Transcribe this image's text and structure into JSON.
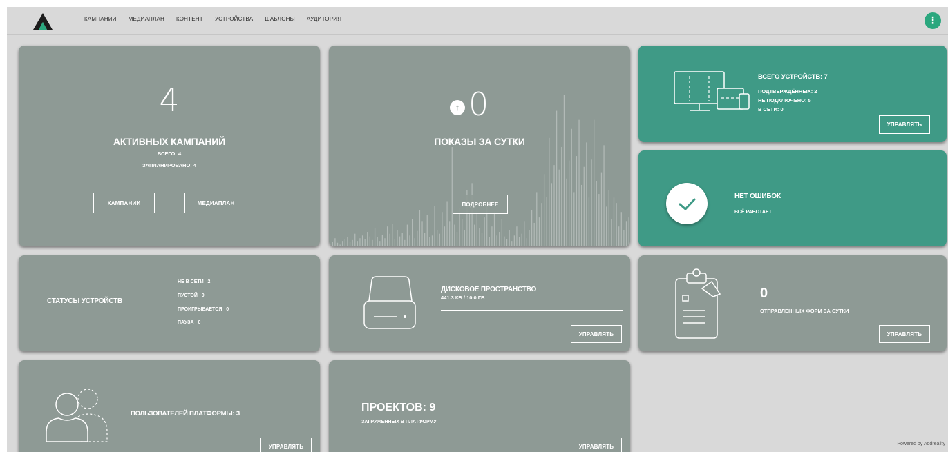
{
  "nav": {
    "items": [
      "КАМПАНИИ",
      "МЕДИАПЛАН",
      "КОНТЕНТ",
      "УСТРОЙСТВА",
      "ШАБЛОНЫ",
      "АУДИТОРИЯ"
    ],
    "menu_icon": "⋮"
  },
  "colors": {
    "card_gray": "#8e9a95",
    "card_teal": "#3f9a86",
    "accent": "#2aa77e"
  },
  "campaigns": {
    "count": "4",
    "title": "АКТИВНЫХ КАМПАНИЙ",
    "total": "ВСЕГО: 4",
    "scheduled": "ЗАПЛАНИРОВАНО: 4",
    "btn_campaigns": "КАМПАНИИ",
    "btn_mediaplan": "МЕДИАПЛАН"
  },
  "impressions": {
    "count": "0",
    "title": "ПОКАЗЫ ЗА СУТКИ",
    "btn_details": "ПОДРОБНЕЕ",
    "bars": [
      3,
      5,
      9,
      4,
      2,
      6,
      8,
      10,
      5,
      7,
      14,
      6,
      9,
      12,
      8,
      16,
      11,
      7,
      20,
      10,
      6,
      13,
      9,
      22,
      14,
      25,
      8,
      18,
      11,
      15,
      7,
      24,
      12,
      30,
      9,
      17,
      40,
      28,
      15,
      35,
      10,
      12,
      45,
      18,
      14,
      38,
      22,
      50,
      28,
      110,
      24,
      16,
      42,
      30,
      18,
      62,
      36,
      70,
      24,
      40,
      20,
      15,
      32,
      48,
      10,
      22,
      38,
      12,
      16,
      30,
      11,
      8,
      18,
      6,
      12,
      22,
      10,
      14,
      28,
      9,
      18,
      40,
      26,
      60,
      32,
      48,
      80,
      55,
      120,
      70,
      90,
      150,
      85,
      110,
      168,
      75,
      95,
      130,
      60,
      100,
      140,
      68,
      88,
      115,
      54,
      96,
      140,
      72,
      58,
      82,
      112,
      44,
      62,
      30,
      54,
      48,
      22,
      38,
      18,
      28,
      32
    ]
  },
  "devices": {
    "total": "ВСЕГО УСТРОЙСТВ: 7",
    "confirmed": "ПОДТВЕРЖДЁННЫХ: 2",
    "not_connected": "НЕ ПОДКЛЮЧЕНО: 5",
    "online": "В СЕТИ: 0",
    "btn_manage": "УПРАВЛЯТЬ"
  },
  "errors": {
    "title": "НЕТ ОШИБОК",
    "subtitle": "ВСЁ РАБОТАЕТ"
  },
  "device_status": {
    "title": "СТАТУСЫ УСТРОЙСТВ",
    "rows": [
      {
        "label": "НЕ В СЕТИ",
        "value": "2"
      },
      {
        "label": "ПУСТОЙ",
        "value": "0"
      },
      {
        "label": "ПРОИГРЫВАЕТСЯ",
        "value": "0"
      },
      {
        "label": "ПАУЗА",
        "value": "0"
      }
    ]
  },
  "disk": {
    "title": "ДИСКОВОЕ ПРОСТРАНСТВО",
    "usage": "441.3 КБ / 10.0 ГБ",
    "usage_fraction": 4e-05,
    "btn_manage": "УПРАВЛЯТЬ"
  },
  "forms": {
    "count": "0",
    "title": "ОТПРАВЛЕННЫХ ФОРМ ЗА СУТКИ",
    "btn_manage": "УПРАВЛЯТЬ"
  },
  "users": {
    "title": "ПОЛЬЗОВАТЕЛЕЙ ПЛАТФОРМЫ: 3",
    "btn_manage": "УПРАВЛЯТЬ"
  },
  "projects": {
    "title": "ПРОЕКТОВ: 9",
    "subtitle": "ЗАГРУЖЕННЫХ В ПЛАТФОРМУ",
    "btn_manage": "УПРАВЛЯТЬ"
  },
  "footer": {
    "powered": "Powered by Addreality"
  }
}
